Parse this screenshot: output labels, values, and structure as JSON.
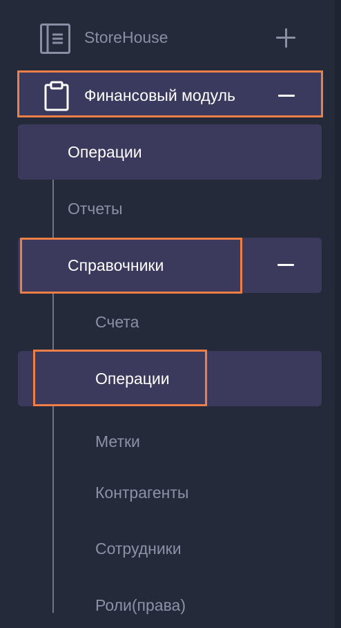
{
  "app": {
    "title": "StoreHouse",
    "expand_symbol": "+"
  },
  "module": {
    "title": "Финансовый модуль",
    "collapse_symbol": "−"
  },
  "items": [
    {
      "label": "Операции",
      "state": "selected"
    },
    {
      "label": "Отчеты",
      "state": "normal"
    },
    {
      "label": "Справочники",
      "state": "expanded"
    }
  ],
  "sub_items": [
    {
      "label": "Счета",
      "state": "normal"
    },
    {
      "label": "Операции",
      "state": "selected"
    },
    {
      "label": "Метки",
      "state": "normal"
    },
    {
      "label": "Контрагенты",
      "state": "normal"
    },
    {
      "label": "Сотрудники",
      "state": "normal"
    },
    {
      "label": "Роли(права)",
      "state": "normal"
    }
  ],
  "colors": {
    "background": "#252a3b",
    "selected_bg": "#3b3a5c",
    "highlight_border": "#f07f45",
    "text_active": "#ffffff",
    "text_muted": "#8d91a8"
  },
  "icons": {
    "app": "document-list-icon",
    "module": "clipboard-icon",
    "expand": "plus-icon",
    "collapse": "minus-icon"
  }
}
